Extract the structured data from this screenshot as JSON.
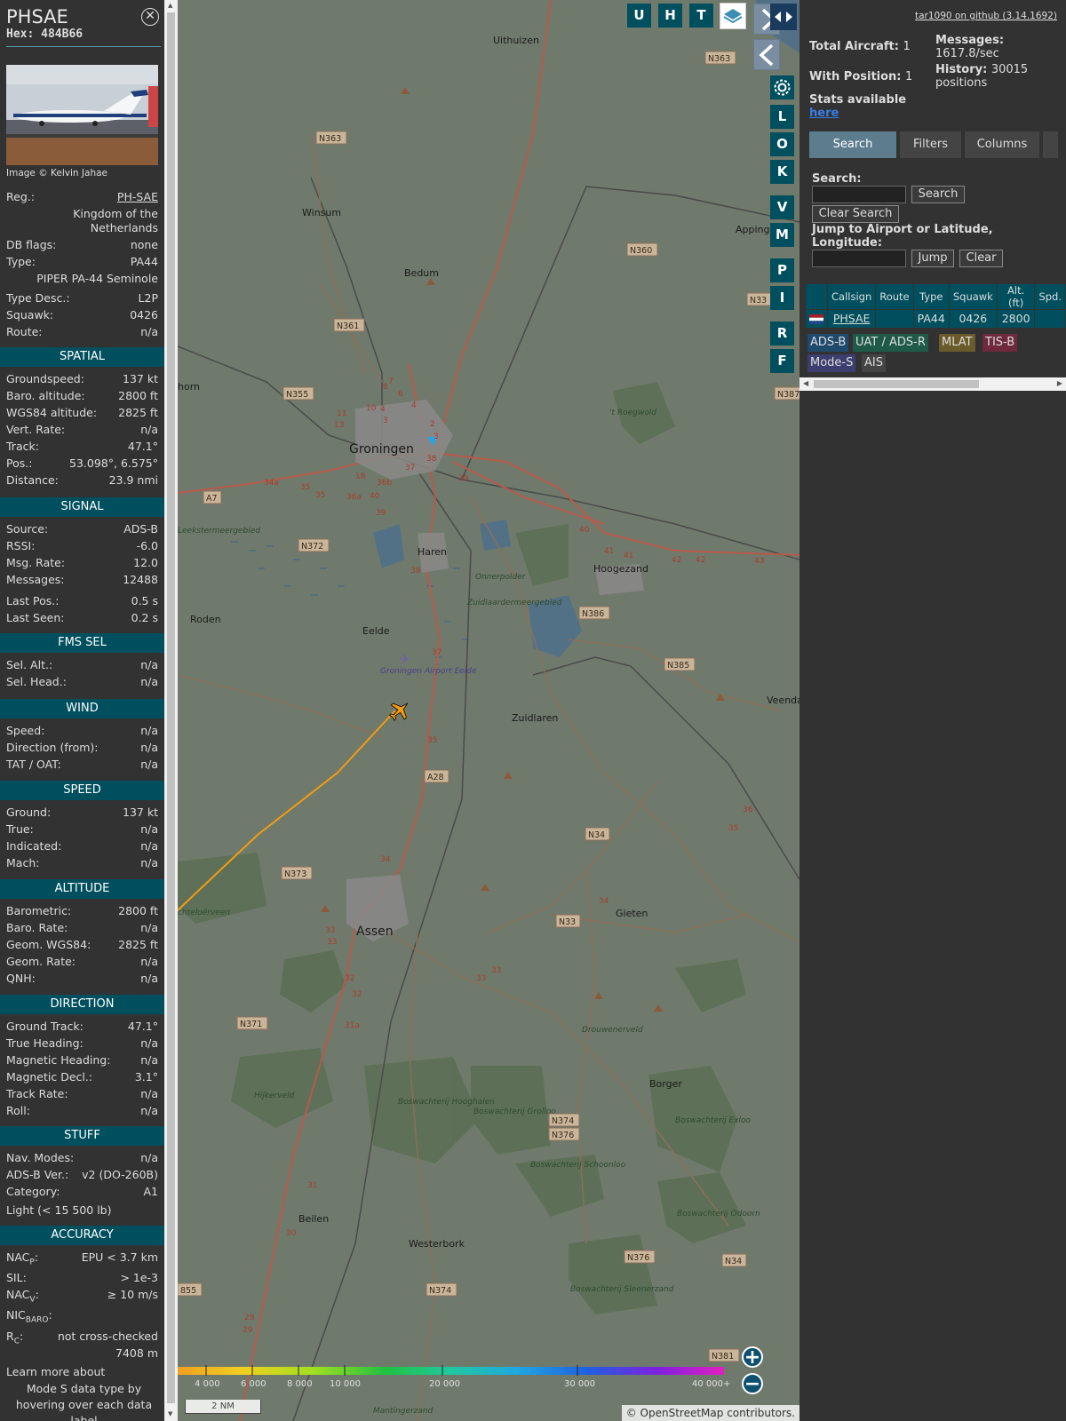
{
  "aircraft": {
    "callsign": "PHSAE",
    "hex": "Hex: 484B66",
    "close_icon": "close-circle-icon",
    "photo_credit": "Image © Kelvin Jahae",
    "reg_label": "Reg.:",
    "reg_value": "PH-SAE",
    "country_line1": "Kingdom of the",
    "country_line2": "Netherlands",
    "dbflags_label": "DB flags:",
    "dbflags_value": "none",
    "type_label": "Type:",
    "type_value": "PA44",
    "type_full": "PIPER PA-44 Seminole",
    "typedesc_label": "Type Desc.:",
    "typedesc_value": "L2P",
    "squawk_label": "Squawk:",
    "squawk_value": "0426",
    "route_label": "Route:",
    "route_value": "n/a"
  },
  "sections": {
    "spatial": {
      "title": "SPATIAL",
      "rows": [
        {
          "k": "Groundspeed:",
          "v": "137 kt"
        },
        {
          "k": "Baro. altitude:",
          "v": "2800 ft"
        },
        {
          "k": "WGS84 altitude:",
          "v": "2825 ft"
        },
        {
          "k": "Vert. Rate:",
          "v": "n/a"
        },
        {
          "k": "Track:",
          "v": "47.1°"
        },
        {
          "k": "Pos.:",
          "v": "53.098°, 6.575°"
        },
        {
          "k": "Distance:",
          "v": "23.9 nmi"
        }
      ]
    },
    "signal": {
      "title": "SIGNAL",
      "rows": [
        {
          "k": "Source:",
          "v": "ADS-B"
        },
        {
          "k": "RSSI:",
          "v": "-6.0"
        },
        {
          "k": "Msg. Rate:",
          "v": "12.0"
        },
        {
          "k": "Messages:",
          "v": "12488"
        },
        {
          "k": "Last Pos.:",
          "v": "0.5 s"
        },
        {
          "k": "Last Seen:",
          "v": "0.2 s"
        }
      ]
    },
    "fmssel": {
      "title": "FMS SEL",
      "rows": [
        {
          "k": "Sel. Alt.:",
          "v": "n/a"
        },
        {
          "k": "Sel. Head.:",
          "v": "n/a"
        }
      ]
    },
    "wind": {
      "title": "WIND",
      "rows": [
        {
          "k": "Speed:",
          "v": "n/a"
        },
        {
          "k": "Direction (from):",
          "v": "n/a"
        },
        {
          "k": "TAT / OAT:",
          "v": "n/a"
        }
      ]
    },
    "speed": {
      "title": "SPEED",
      "rows": [
        {
          "k": "Ground:",
          "v": "137 kt"
        },
        {
          "k": "True:",
          "v": "n/a"
        },
        {
          "k": "Indicated:",
          "v": "n/a"
        },
        {
          "k": "Mach:",
          "v": "n/a"
        }
      ]
    },
    "altitude": {
      "title": "ALTITUDE",
      "rows": [
        {
          "k": "Barometric:",
          "v": "2800 ft"
        },
        {
          "k": "Baro. Rate:",
          "v": "n/a"
        },
        {
          "k": "Geom. WGS84:",
          "v": "2825 ft"
        },
        {
          "k": "Geom. Rate:",
          "v": "n/a"
        },
        {
          "k": "QNH:",
          "v": "n/a"
        }
      ]
    },
    "direction": {
      "title": "DIRECTION",
      "rows": [
        {
          "k": "Ground Track:",
          "v": "47.1°"
        },
        {
          "k": "True Heading:",
          "v": "n/a"
        },
        {
          "k": "Magnetic Heading:",
          "v": "n/a"
        },
        {
          "k": "Magnetic Decl.:",
          "v": "3.1°"
        },
        {
          "k": "Track Rate:",
          "v": "n/a"
        },
        {
          "k": "Roll:",
          "v": "n/a"
        }
      ]
    },
    "stuff": {
      "title": "STUFF",
      "rows": [
        {
          "k": "Nav. Modes:",
          "v": "n/a"
        },
        {
          "k": "ADS-B Ver.:",
          "v": "v2 (DO-260B)"
        },
        {
          "k": "Category:",
          "v": "A1"
        }
      ],
      "category_desc": "Light (< 15 500 lb)"
    },
    "accuracy": {
      "title": "ACCURACY",
      "nacp_k": "NAC",
      "nacp_sub": "P",
      "nacp_v": "EPU < 3.7 km",
      "sil_k": "SIL:",
      "sil_v": "> 1e-3",
      "nacv_k": "NAC",
      "nacv_sub": "V",
      "nacv_v": "≥ 10 m/s",
      "nicbaro_k": "NIC",
      "nicbaro_sub": "BARO",
      "rc_k": "R",
      "rc_sub": "C",
      "rc_v": "not cross-checked",
      "rc_v2": "7408 m",
      "learn1": "Learn more about",
      "learn2": "Mode S data type by",
      "learn3": "hovering over each data",
      "learn4": "label"
    }
  },
  "map": {
    "top_buttons": [
      "U",
      "H",
      "T"
    ],
    "side_buttons": [
      "L",
      "O",
      "K",
      "V",
      "M",
      "P",
      "I",
      "R",
      "F"
    ],
    "icons": [
      "layers-icon",
      "chevron-right-icon",
      "chevron-left-icon",
      "gear-icon",
      "expand-horizontal-icon",
      "zoom-in-icon",
      "zoom-out-icon",
      "aircraft-icon"
    ],
    "places": [
      {
        "n": "Uithuizen"
      },
      {
        "n": "Winsum"
      },
      {
        "n": "Bedum"
      },
      {
        "n": "Appinge"
      },
      {
        "n": "Groningen"
      },
      {
        "n": "Leekstermeergebied"
      },
      {
        "n": "Haren"
      },
      {
        "n": "Hoogezand"
      },
      {
        "n": "Onnerpolder"
      },
      {
        "n": "Zuidlaardermeergebied"
      },
      {
        "n": "Roden"
      },
      {
        "n": "Eelde"
      },
      {
        "n": "Groningen Airport Eelde"
      },
      {
        "n": "Zuidlaren"
      },
      {
        "n": "Veendam"
      },
      {
        "n": "Assen"
      },
      {
        "n": "Gieten"
      },
      {
        "n": "Drouwenerveld"
      },
      {
        "n": "Borger"
      },
      {
        "n": "Hijkerveld"
      },
      {
        "n": "Boswachterij Hooghalen"
      },
      {
        "n": "Boswachterij Grolloo"
      },
      {
        "n": "Boswachterij Schoonloo"
      },
      {
        "n": "Boswachterij Exloo"
      },
      {
        "n": "Boswachterij Odoorn"
      },
      {
        "n": "Beilen"
      },
      {
        "n": "Westerbork"
      },
      {
        "n": "Boswachterij Sleenerzand"
      },
      {
        "n": "Mantingerzand"
      },
      {
        "n": "chteloërveen"
      },
      {
        "n": "horn"
      },
      {
        "n": "'t Roegwold"
      }
    ],
    "road_shields": [
      "N363",
      "N363",
      "N360",
      "N361",
      "N355",
      "N33",
      "N387",
      "A7",
      "N372",
      "N386",
      "N385",
      "A28",
      "N34",
      "N373",
      "N33",
      "N371",
      "N374",
      "N376",
      "N376",
      "N374",
      "N34",
      "N381",
      "855"
    ],
    "altitude_scale": [
      "4 000",
      "6 000",
      "8 000",
      "10 000",
      "20 000",
      "30 000",
      "40 000+"
    ],
    "scale_label": "2 NM",
    "attribution_pre": "© ",
    "attribution_link": "OpenStreetMap",
    "attribution_post": " contributors."
  },
  "panel": {
    "github_link": "tar1090 on github (3.14.1692)",
    "total_aircraft_label": "Total Aircraft:",
    "total_aircraft_value": "1",
    "with_position_label": "With Position:",
    "with_position_value": "1",
    "messages_label": "Messages:",
    "messages_value": "1617.8/sec",
    "history_label": "History:",
    "history_value": "30015",
    "history_unit": "positions",
    "stats_label": "Stats available",
    "stats_link": "here",
    "tabs": [
      "Search",
      "Filters",
      "Columns"
    ],
    "search_label": "Search:",
    "search_button": "Search",
    "clear_search_button": "Clear Search",
    "jump_label1": "Jump to Airport or Latitude,",
    "jump_label2": "Longitude:",
    "jump_button": "Jump",
    "clear_button": "Clear",
    "table_headers": [
      "Callsign",
      "Route",
      "Type",
      "Squawk",
      "Alt. (ft)",
      "Spd."
    ],
    "table_rows": [
      {
        "callsign": "PHSAE",
        "route": "",
        "type": "PA44",
        "squawk": "0426",
        "alt": "2800",
        "spd": ""
      }
    ],
    "source_tags": [
      "ADS-B",
      "UAT / ADS-R",
      "MLAT",
      "TIS-B",
      "Mode-S",
      "AIS"
    ]
  },
  "colors": {
    "accent": "#004f5e",
    "track_line": "#f39c12",
    "tag_adsb": "#1e4a6e",
    "tag_uat": "#1f5a48",
    "tag_mlat": "#6b5a2a",
    "tag_tisb": "#6e2a3c",
    "tag_modes": "#3b3e6e",
    "tag_ais": "#444444"
  }
}
